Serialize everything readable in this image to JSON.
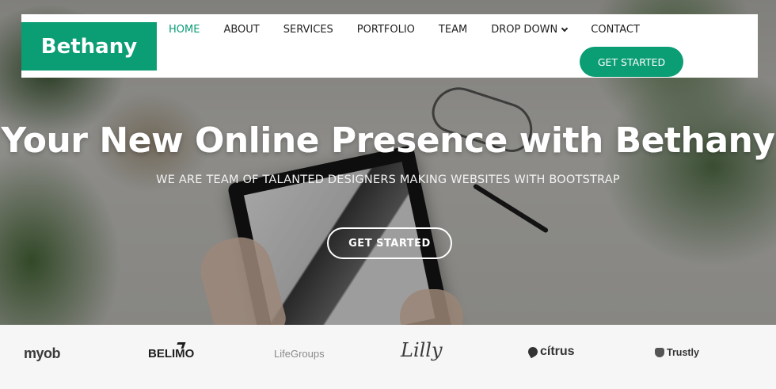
{
  "brand": {
    "name": "Bethany",
    "color": "#0b9d74"
  },
  "nav": {
    "items": [
      {
        "label": "HOME",
        "active": true
      },
      {
        "label": "ABOUT",
        "active": false
      },
      {
        "label": "SERVICES",
        "active": false
      },
      {
        "label": "PORTFOLIO",
        "active": false
      },
      {
        "label": "TEAM",
        "active": false
      },
      {
        "label": "DROP DOWN",
        "active": false,
        "icon": "chevron-down-icon"
      },
      {
        "label": "CONTACT",
        "active": false
      }
    ],
    "cta_label": "GET STARTED"
  },
  "hero": {
    "title": "Your New Online Presence with Bethany",
    "subtitle": "WE ARE TEAM OF TALANTED DESIGNERS MAKING WEBSITES WITH BOOTSTRAP",
    "cta_label": "GET STARTED"
  },
  "clients": [
    {
      "name": "myob"
    },
    {
      "name": "BELIMO"
    },
    {
      "name": "LifeGroups"
    },
    {
      "name": "Lilly"
    },
    {
      "name": "cítrus"
    },
    {
      "name": "Trustly"
    }
  ]
}
